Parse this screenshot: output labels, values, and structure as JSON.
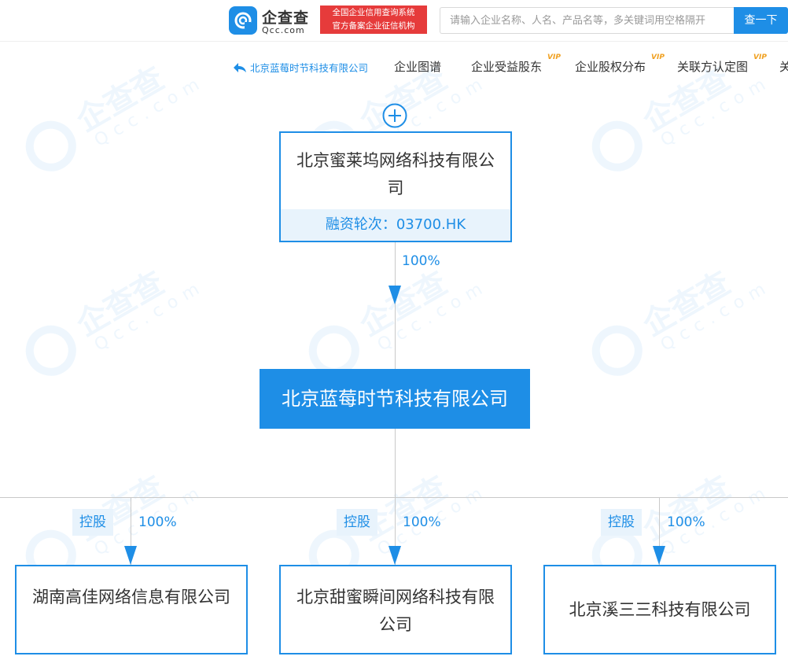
{
  "header": {
    "logo_name": "企查查",
    "logo_domain": "Qcc.com",
    "badge_line1": "全国企业信用查询系统",
    "badge_line2": "官方备案企业征信机构",
    "search_placeholder": "请输入企业名称、人名、产品名等，多关键词用空格隔开",
    "search_button": "查一下"
  },
  "nav": {
    "back_label": "北京蓝莓时节科技有限公司",
    "tabs": [
      {
        "label": "企业图谱",
        "vip": ""
      },
      {
        "label": "企业受益股东",
        "vip": "VIP"
      },
      {
        "label": "企业股权分布",
        "vip": "VIP"
      },
      {
        "label": "关联方认定图",
        "vip": "VIP"
      },
      {
        "label": "关",
        "vip": ""
      }
    ]
  },
  "watermark": {
    "brand": "企查查",
    "domain": "Qcc.com"
  },
  "graph": {
    "parent": {
      "name": "北京蜜莱坞网络科技有限公司",
      "financing": "融资轮次：03700.HK",
      "share": "100%"
    },
    "main": {
      "name": "北京蓝莓时节科技有限公司"
    },
    "children": [
      {
        "tag": "控股",
        "share": "100%",
        "name": "湖南高佳网络信息有限公司"
      },
      {
        "tag": "控股",
        "share": "100%",
        "name": "北京甜蜜瞬间网络科技有限公司"
      },
      {
        "tag": "控股",
        "share": "100%",
        "name": "北京溪三三科技有限公司"
      }
    ]
  }
}
